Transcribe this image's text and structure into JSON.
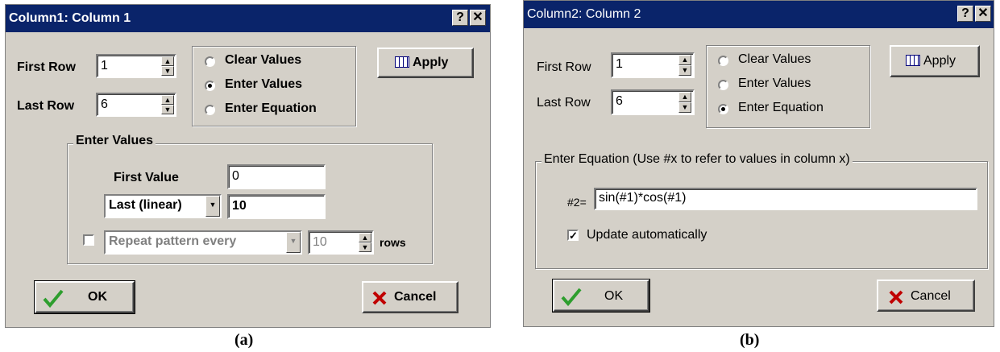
{
  "dialog_a": {
    "title": "Column1: Column 1",
    "help_glyph": "?",
    "close_glyph": "✕",
    "first_row_label": "First Row",
    "first_row_value": "1",
    "last_row_label": "Last Row",
    "last_row_value": "6",
    "radio_clear": "Clear Values",
    "radio_enter": "Enter Values",
    "radio_equation": "Enter Equation",
    "selected_mode": "Enter Values",
    "apply_label": "Apply",
    "group_title": "Enter Values",
    "first_value_label": "First Value",
    "first_value": "0",
    "last_mode_select": "Last (linear)",
    "last_value": "10",
    "repeat_checked": false,
    "repeat_label": "Repeat pattern every",
    "repeat_value": "10",
    "rows_label": "rows",
    "ok_label": "OK",
    "cancel_label": "Cancel"
  },
  "dialog_b": {
    "title": "Column2:  Column 2",
    "help_glyph": "?",
    "close_glyph": "✕",
    "first_row_label": "First Row",
    "first_row_value": "1",
    "last_row_label": "Last Row",
    "last_row_value": "6",
    "radio_clear": "Clear Values",
    "radio_enter": "Enter Values",
    "radio_equation": "Enter Equation",
    "selected_mode": "Enter Equation",
    "apply_label": "Apply",
    "group_title": "Enter Equation (Use #x to refer to values in column x)",
    "eq_label": "#2=",
    "eq_value": "sin(#1)*cos(#1)",
    "update_checked": true,
    "update_label": "Update automatically",
    "ok_label": "OK",
    "cancel_label": "Cancel"
  },
  "captions": {
    "a": "(a)",
    "b": "(b)"
  },
  "colors": {
    "titlebar": "#0a246a",
    "face": "#d4d0c8",
    "ok_check": "#2e9e2e",
    "cancel_x": "#c00000"
  },
  "icons": {
    "apply": "grid-table-icon",
    "ok": "checkmark-icon",
    "cancel": "red-x-icon"
  }
}
